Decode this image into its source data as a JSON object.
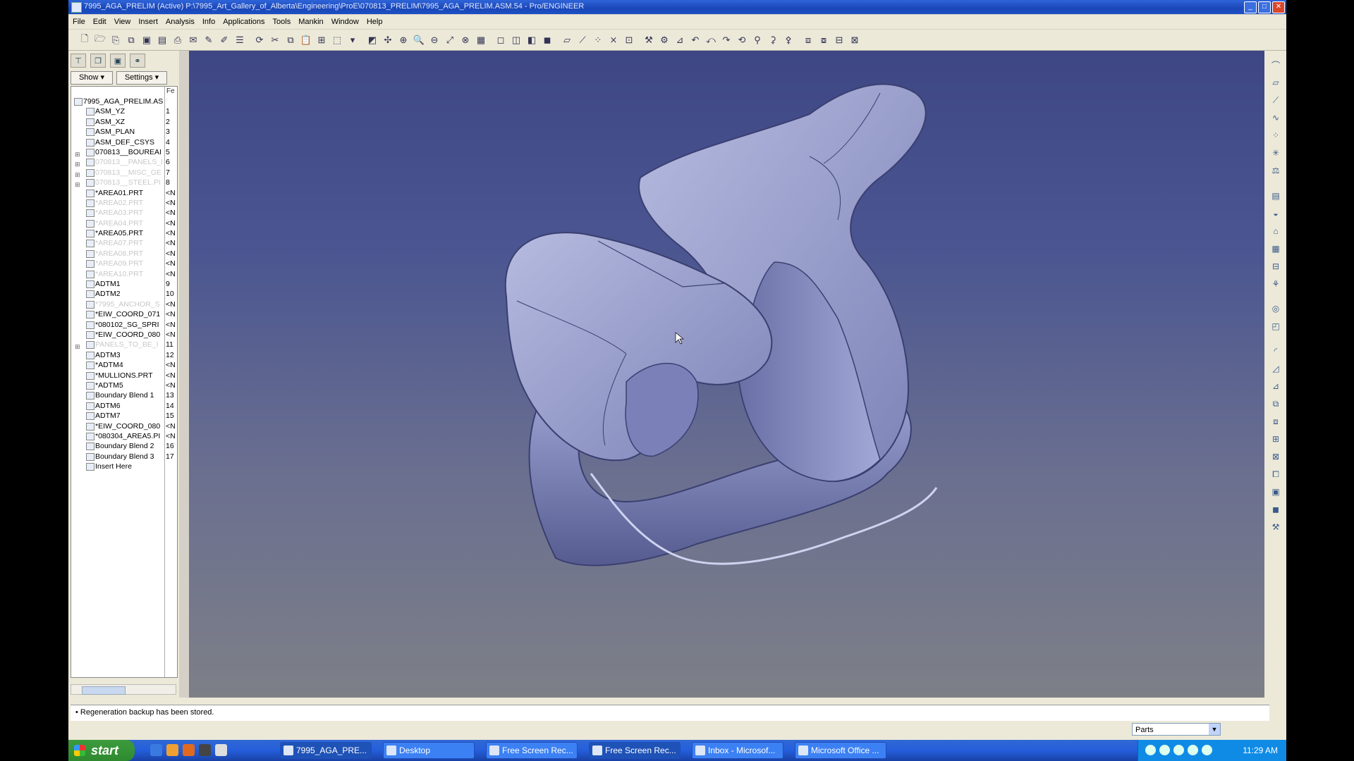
{
  "window": {
    "title": "7995_AGA_PRELIM (Active) P:\\7995_Art_Gallery_of_Alberta\\Engineering\\ProE\\070813_PRELIM\\7995_AGA_PRELIM.ASM.54 - Pro/ENGINEER"
  },
  "menubar": [
    "File",
    "Edit",
    "View",
    "Insert",
    "Analysis",
    "Info",
    "Applications",
    "Tools",
    "Mankin",
    "Window",
    "Help"
  ],
  "left_panel": {
    "show_label": "Show ▾",
    "settings_label": "Settings ▾",
    "column_header": "Fe",
    "root": "7995_AGA_PRELIM.AS",
    "items": [
      {
        "label": "ASM_YZ",
        "num": "1",
        "dim": false
      },
      {
        "label": "ASM_XZ",
        "num": "2",
        "dim": false
      },
      {
        "label": "ASM_PLAN",
        "num": "3",
        "dim": false
      },
      {
        "label": "ASM_DEF_CSYS",
        "num": "4",
        "dim": false
      },
      {
        "label": "070813__BOUREAI",
        "num": "5",
        "dim": false
      },
      {
        "label": "070813__PANELS_F",
        "num": "6",
        "dim": true
      },
      {
        "label": "070813__MISC_GE",
        "num": "7",
        "dim": true
      },
      {
        "label": "070813__STEEL.PI",
        "num": "8",
        "dim": true
      },
      {
        "label": "*AREA01.PRT",
        "num": "<N",
        "dim": false
      },
      {
        "label": "*AREA02.PRT",
        "num": "<N",
        "dim": true
      },
      {
        "label": "*AREA03.PRT",
        "num": "<N",
        "dim": true
      },
      {
        "label": "*AREA04.PRT",
        "num": "<N",
        "dim": true
      },
      {
        "label": "*AREA05.PRT",
        "num": "<N",
        "dim": false
      },
      {
        "label": "*AREA07.PRT",
        "num": "<N",
        "dim": true
      },
      {
        "label": "*AREA08.PRT",
        "num": "<N",
        "dim": true
      },
      {
        "label": "*AREA09.PRT",
        "num": "<N",
        "dim": true
      },
      {
        "label": "*AREA10.PRT",
        "num": "<N",
        "dim": true
      },
      {
        "label": "ADTM1",
        "num": "9",
        "dim": false
      },
      {
        "label": "ADTM2",
        "num": "10",
        "dim": false
      },
      {
        "label": "*7995_ANCHOR_S",
        "num": "<N",
        "dim": true
      },
      {
        "label": "*EIW_COORD_071",
        "num": "<N",
        "dim": false
      },
      {
        "label": "*080102_SG_SPRI",
        "num": "<N",
        "dim": false
      },
      {
        "label": "*EIW_COORD_080",
        "num": "<N",
        "dim": false
      },
      {
        "label": "PANELS_TO_BE_I",
        "num": "11",
        "dim": true
      },
      {
        "label": "ADTM3",
        "num": "12",
        "dim": false
      },
      {
        "label": "*ADTM4",
        "num": "<N",
        "dim": false
      },
      {
        "label": "*MULLIONS.PRT",
        "num": "<N",
        "dim": false
      },
      {
        "label": "*ADTM5",
        "num": "<N",
        "dim": false
      },
      {
        "label": "Boundary Blend 1",
        "num": "13",
        "dim": false
      },
      {
        "label": "ADTM6",
        "num": "14",
        "dim": false
      },
      {
        "label": "ADTM7",
        "num": "15",
        "dim": false
      },
      {
        "label": "*EIW_COORD_080",
        "num": "<N",
        "dim": false
      },
      {
        "label": "*080304_AREA5.PI",
        "num": "<N",
        "dim": false
      },
      {
        "label": "Boundary Blend 2",
        "num": "16",
        "dim": false
      },
      {
        "label": "Boundary Blend 3",
        "num": "17",
        "dim": false
      },
      {
        "label": "Insert Here",
        "num": "",
        "dim": false
      }
    ]
  },
  "status": {
    "message": "• Regeneration backup has been stored.",
    "filter_value": "Parts"
  },
  "taskbar": {
    "start_label": "start",
    "tasks": [
      "7995_AGA_PRE...",
      "Desktop",
      "Free Screen Rec...",
      "Free Screen Rec...",
      "Inbox - Microsof...",
      "Microsoft Office ..."
    ],
    "clock": "11:29 AM"
  },
  "colors": {
    "viewport_top": "#3e4784",
    "viewport_bottom": "#7d7f87",
    "model_fill": "#8f96c4"
  }
}
